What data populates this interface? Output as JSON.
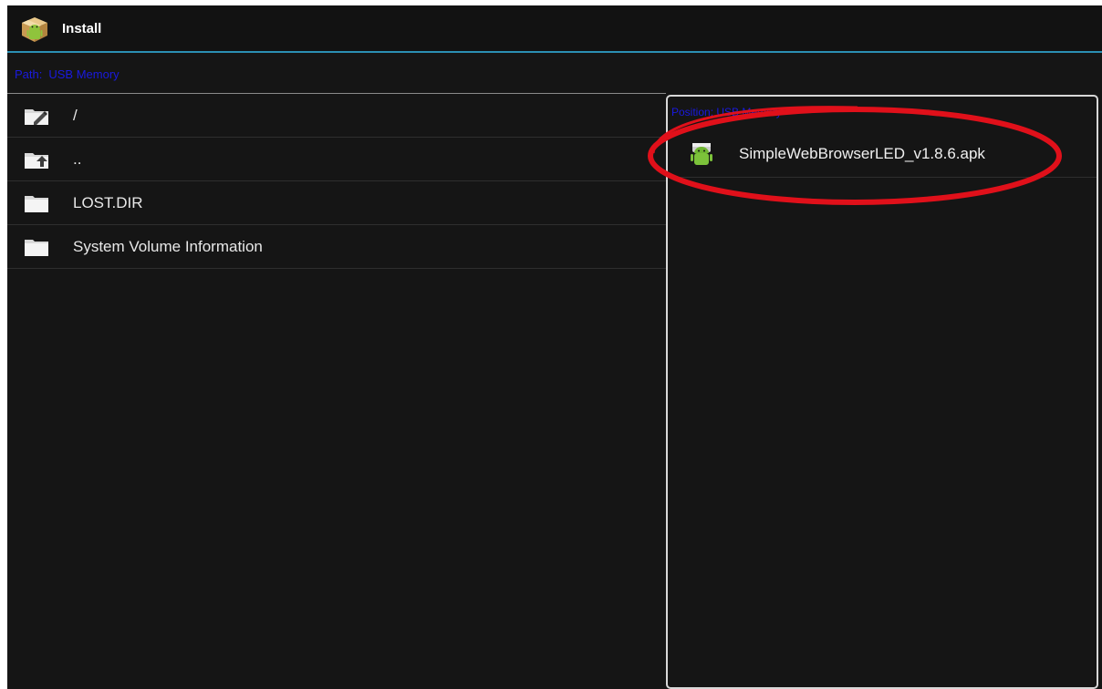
{
  "window": {
    "title": "Install",
    "app_icon": "package-android-icon"
  },
  "pathbar": {
    "label": "Path:",
    "value": "USB Memory"
  },
  "file_list": [
    {
      "label": "/",
      "icon": "folder-edit-icon"
    },
    {
      "label": "..",
      "icon": "folder-up-icon"
    },
    {
      "label": "LOST.DIR",
      "icon": "folder-icon"
    },
    {
      "label": "System Volume Information",
      "icon": "folder-icon"
    }
  ],
  "right_panel": {
    "header": "Position: USB Memory",
    "items": [
      {
        "label": "SimpleWebBrowserLED_v1.8.6.apk",
        "icon": "apk-android-icon"
      }
    ]
  },
  "colors": {
    "background": "#151515",
    "accent_line": "#2b8fb3",
    "path_text": "#1a1adf",
    "annotation": "#e0101a"
  }
}
